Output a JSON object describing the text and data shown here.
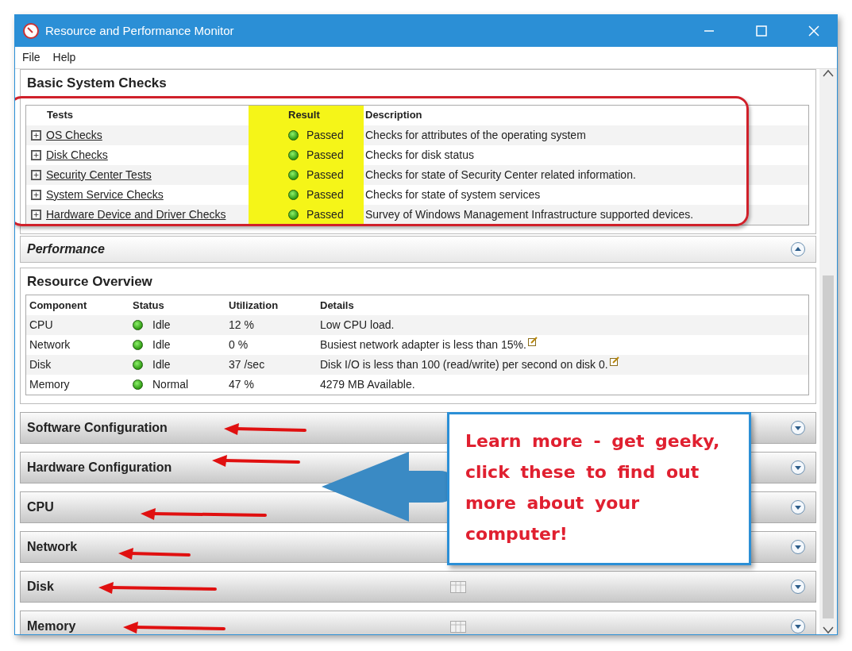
{
  "window": {
    "title": "Resource and Performance Monitor"
  },
  "menu": [
    "File",
    "Help"
  ],
  "basic_checks": {
    "title": "Basic System Checks",
    "columns": [
      "Tests",
      "Result",
      "Description"
    ],
    "rows": [
      {
        "test": "OS Checks",
        "result": "Passed",
        "description": "Checks for attributes of the operating system"
      },
      {
        "test": "Disk Checks",
        "result": "Passed",
        "description": "Checks for disk status"
      },
      {
        "test": "Security Center Tests",
        "result": "Passed",
        "description": "Checks for state of Security Center related information."
      },
      {
        "test": "System Service Checks",
        "result": "Passed",
        "description": "Checks for state of system services"
      },
      {
        "test": "Hardware Device and Driver Checks",
        "result": "Passed",
        "description": "Survey of Windows Management Infrastructure supported devices."
      }
    ]
  },
  "performance": {
    "title": "Performance",
    "expanded": true
  },
  "resource_overview": {
    "title": "Resource Overview",
    "columns": [
      "Component",
      "Status",
      "Utilization",
      "Details"
    ],
    "rows": [
      {
        "component": "CPU",
        "status": "Idle",
        "utilization": "12 %",
        "details": "Low CPU load.",
        "note": false
      },
      {
        "component": "Network",
        "status": "Idle",
        "utilization": "0 %",
        "details": "Busiest network adapter is less than 15%.",
        "note": true
      },
      {
        "component": "Disk",
        "status": "Idle",
        "utilization": "37 /sec",
        "details": "Disk I/O is less than 100 (read/write) per second on disk 0.",
        "note": true
      },
      {
        "component": "Memory",
        "status": "Normal",
        "utilization": "47 %",
        "details": "4279 MB Available.",
        "note": false
      }
    ]
  },
  "sections": [
    {
      "title": "Software Configuration",
      "expanded": false,
      "grid_icon": false
    },
    {
      "title": "Hardware Configuration",
      "expanded": false,
      "grid_icon": false
    },
    {
      "title": "CPU",
      "expanded": false,
      "grid_icon": false
    },
    {
      "title": "Network",
      "expanded": false,
      "grid_icon": false
    },
    {
      "title": "Disk",
      "expanded": false,
      "grid_icon": true
    },
    {
      "title": "Memory",
      "expanded": false,
      "grid_icon": true
    }
  ],
  "annotation": {
    "callout": "Learn more - get geeky, click these to find out more about your computer!"
  }
}
